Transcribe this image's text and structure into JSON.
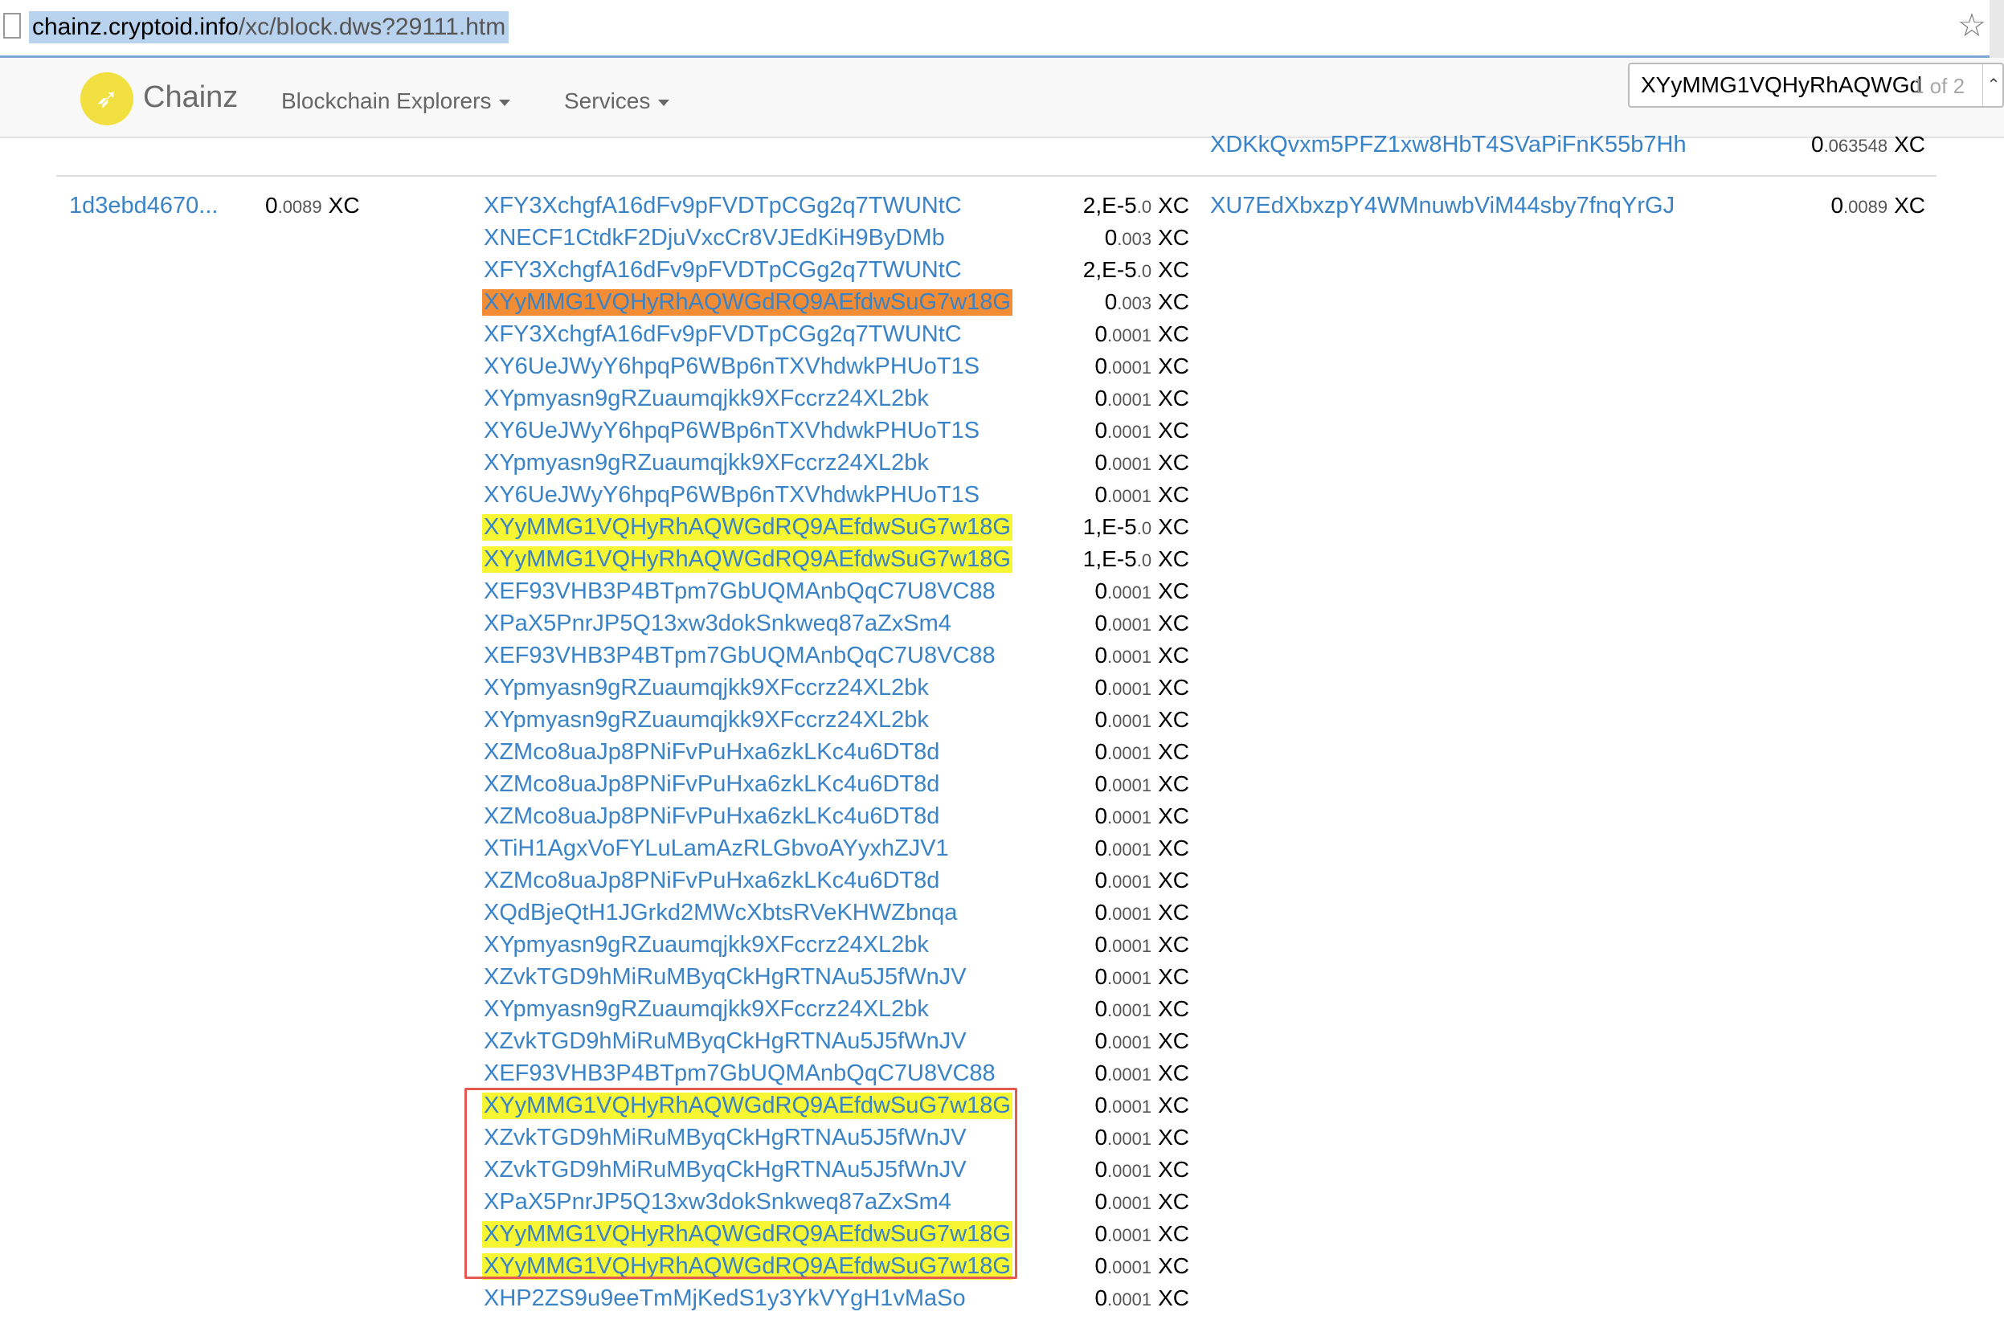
{
  "browser": {
    "url_host": "chainz.cryptoid.info",
    "url_path": "/xc/block.dws?29111.htm"
  },
  "navbar": {
    "brand": "Chainz",
    "menu": [
      "Blockchain Explorers",
      "Services"
    ]
  },
  "find": {
    "query": "XYyMMG1VQHyRhAQWGd",
    "count": "1 of 2"
  },
  "prev_row": {
    "output_address": "XDKkQvxm5PFZ1xw8HbT4SVaPiFnK55b7Hh",
    "amount_int": "0",
    "amount_dec": ".063548",
    "unit": "XC"
  },
  "transaction": {
    "hash": "1d3ebd4670...",
    "total_int": "0",
    "total_dec": ".0089",
    "unit": "XC",
    "output_address": "XU7EdXbxzpY4WMnuwbViM44sby7fnqYrGJ",
    "output_int": "0",
    "output_dec": ".0089",
    "inputs": [
      {
        "address": "XFY3XchgfA16dFv9pFVDTpCGg2q7TWUNtC",
        "int": "2,E-5",
        "dec": ".0",
        "hl": "none"
      },
      {
        "address": "XNECF1CtdkF2DjuVxcCr8VJEdKiH9ByDMb",
        "int": "0",
        "dec": ".003",
        "hl": "none"
      },
      {
        "address": "XFY3XchgfA16dFv9pFVDTpCGg2q7TWUNtC",
        "int": "2,E-5",
        "dec": ".0",
        "hl": "none"
      },
      {
        "address": "XYyMMG1VQHyRhAQWGdRQ9AEfdwSuG7w18G",
        "int": "0",
        "dec": ".003",
        "hl": "active"
      },
      {
        "address": "XFY3XchgfA16dFv9pFVDTpCGg2q7TWUNtC",
        "int": "0",
        "dec": ".0001",
        "hl": "none"
      },
      {
        "address": "XY6UeJWyY6hpqP6WBp6nTXVhdwkPHUoT1S",
        "int": "0",
        "dec": ".0001",
        "hl": "none"
      },
      {
        "address": "XYpmyasn9gRZuaumqjkk9XFccrz24XL2bk",
        "int": "0",
        "dec": ".0001",
        "hl": "none"
      },
      {
        "address": "XY6UeJWyY6hpqP6WBp6nTXVhdwkPHUoT1S",
        "int": "0",
        "dec": ".0001",
        "hl": "none"
      },
      {
        "address": "XYpmyasn9gRZuaumqjkk9XFccrz24XL2bk",
        "int": "0",
        "dec": ".0001",
        "hl": "none"
      },
      {
        "address": "XY6UeJWyY6hpqP6WBp6nTXVhdwkPHUoT1S",
        "int": "0",
        "dec": ".0001",
        "hl": "none"
      },
      {
        "address": "XYyMMG1VQHyRhAQWGdRQ9AEfdwSuG7w18G",
        "int": "1,E-5",
        "dec": ".0",
        "hl": "match"
      },
      {
        "address": "XYyMMG1VQHyRhAQWGdRQ9AEfdwSuG7w18G",
        "int": "1,E-5",
        "dec": ".0",
        "hl": "match"
      },
      {
        "address": "XEF93VHB3P4BTpm7GbUQMAnbQqC7U8VC88",
        "int": "0",
        "dec": ".0001",
        "hl": "none"
      },
      {
        "address": "XPaX5PnrJP5Q13xw3dokSnkweq87aZxSm4",
        "int": "0",
        "dec": ".0001",
        "hl": "none"
      },
      {
        "address": "XEF93VHB3P4BTpm7GbUQMAnbQqC7U8VC88",
        "int": "0",
        "dec": ".0001",
        "hl": "none"
      },
      {
        "address": "XYpmyasn9gRZuaumqjkk9XFccrz24XL2bk",
        "int": "0",
        "dec": ".0001",
        "hl": "none"
      },
      {
        "address": "XYpmyasn9gRZuaumqjkk9XFccrz24XL2bk",
        "int": "0",
        "dec": ".0001",
        "hl": "none"
      },
      {
        "address": "XZMco8uaJp8PNiFvPuHxa6zkLKc4u6DT8d",
        "int": "0",
        "dec": ".0001",
        "hl": "none"
      },
      {
        "address": "XZMco8uaJp8PNiFvPuHxa6zkLKc4u6DT8d",
        "int": "0",
        "dec": ".0001",
        "hl": "none"
      },
      {
        "address": "XZMco8uaJp8PNiFvPuHxa6zkLKc4u6DT8d",
        "int": "0",
        "dec": ".0001",
        "hl": "none"
      },
      {
        "address": "XTiH1AgxVoFYLuLamAzRLGbvoAYyxhZJV1",
        "int": "0",
        "dec": ".0001",
        "hl": "none"
      },
      {
        "address": "XZMco8uaJp8PNiFvPuHxa6zkLKc4u6DT8d",
        "int": "0",
        "dec": ".0001",
        "hl": "none"
      },
      {
        "address": "XQdBjeQtH1JGrkd2MWcXbtsRVeKHWZbnqa",
        "int": "0",
        "dec": ".0001",
        "hl": "none"
      },
      {
        "address": "XYpmyasn9gRZuaumqjkk9XFccrz24XL2bk",
        "int": "0",
        "dec": ".0001",
        "hl": "none"
      },
      {
        "address": "XZvkTGD9hMiRuMByqCkHgRTNAu5J5fWnJV",
        "int": "0",
        "dec": ".0001",
        "hl": "none"
      },
      {
        "address": "XYpmyasn9gRZuaumqjkk9XFccrz24XL2bk",
        "int": "0",
        "dec": ".0001",
        "hl": "none"
      },
      {
        "address": "XZvkTGD9hMiRuMByqCkHgRTNAu5J5fWnJV",
        "int": "0",
        "dec": ".0001",
        "hl": "none"
      },
      {
        "address": "XEF93VHB3P4BTpm7GbUQMAnbQqC7U8VC88",
        "int": "0",
        "dec": ".0001",
        "hl": "none"
      },
      {
        "address": "XYyMMG1VQHyRhAQWGdRQ9AEfdwSuG7w18G",
        "int": "0",
        "dec": ".0001",
        "hl": "match"
      },
      {
        "address": "XZvkTGD9hMiRuMByqCkHgRTNAu5J5fWnJV",
        "int": "0",
        "dec": ".0001",
        "hl": "none"
      },
      {
        "address": "XZvkTGD9hMiRuMByqCkHgRTNAu5J5fWnJV",
        "int": "0",
        "dec": ".0001",
        "hl": "none"
      },
      {
        "address": "XPaX5PnrJP5Q13xw3dokSnkweq87aZxSm4",
        "int": "0",
        "dec": ".0001",
        "hl": "none"
      },
      {
        "address": "XYyMMG1VQHyRhAQWGdRQ9AEfdwSuG7w18G",
        "int": "0",
        "dec": ".0001",
        "hl": "match"
      },
      {
        "address": "XYyMMG1VQHyRhAQWGdRQ9AEfdwSuG7w18G",
        "int": "0",
        "dec": ".0001",
        "hl": "match"
      },
      {
        "address": "XHP2ZS9u9eeTmMjKedS1y3YkVYgH1vMaSo",
        "int": "0",
        "dec": ".0001",
        "hl": "none"
      }
    ]
  },
  "colors": {
    "link": "#3a83c7",
    "match_highlight": "#f6f632",
    "active_highlight": "#f28c35",
    "annotation_box": "#e45a52",
    "logo": "#f2e040"
  },
  "icons": [
    "page-icon",
    "star-icon",
    "logo-rocket-icon",
    "caret-down-icon",
    "find-up-arrow-icon"
  ]
}
